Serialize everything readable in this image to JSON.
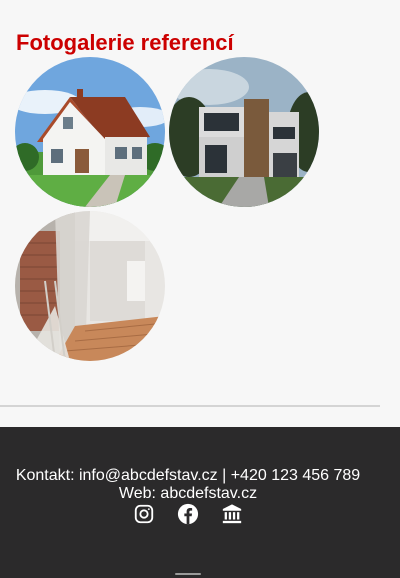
{
  "gallery": {
    "title": "Fotogalerie referencí",
    "images": [
      {
        "alt": "Rodinný dům"
      },
      {
        "alt": "Moderní dům"
      },
      {
        "alt": "Rekonstrukce interiéru"
      }
    ]
  },
  "footer": {
    "contact": "Kontakt: info@abcdefstav.cz | +420 123 456 789",
    "web": "Web: abcdefstav.cz",
    "icons": [
      "instagram-icon",
      "facebook-icon",
      "bank-icon"
    ]
  },
  "colors": {
    "title": "#cc0000",
    "footer_bg": "#2b2a2b",
    "page_bg": "#f7f7f7"
  }
}
